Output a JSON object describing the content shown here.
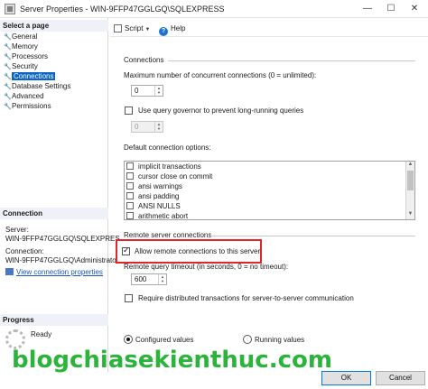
{
  "window": {
    "title": "Server Properties - WIN-9FFP47GGLGQ\\SQLEXPRESS",
    "controls": {
      "minimize": "—",
      "maximize": "☐",
      "close": "✕"
    }
  },
  "left_pane": {
    "select_page_header": "Select a page",
    "pages": [
      {
        "label": "General",
        "selected": false
      },
      {
        "label": "Memory",
        "selected": false
      },
      {
        "label": "Processors",
        "selected": false
      },
      {
        "label": "Security",
        "selected": false
      },
      {
        "label": "Connections",
        "selected": true
      },
      {
        "label": "Database Settings",
        "selected": false
      },
      {
        "label": "Advanced",
        "selected": false
      },
      {
        "label": "Permissions",
        "selected": false
      }
    ],
    "connection_header": "Connection",
    "server_label": "Server:",
    "server_value": "WIN-9FFP47GGLGQ\\SQLEXPRES",
    "connection_label": "Connection:",
    "connection_value": "WIN-9FFP47GGLGQ\\Administrato",
    "view_connection_link": "View connection properties",
    "progress_header": "Progress",
    "progress_status": "Ready"
  },
  "toolbar": {
    "script_label": "Script",
    "help_label": "Help"
  },
  "connections": {
    "group_label": "Connections",
    "max_connections_label": "Maximum number of concurrent connections (0 = unlimited):",
    "max_connections_value": "0",
    "query_governor_label": "Use query governor to prevent long-running queries",
    "query_governor_checked": false,
    "query_governor_value": "0",
    "default_options_label": "Default connection options:",
    "default_options": [
      "implicit transactions",
      "cursor close on commit",
      "ansi warnings",
      "ansi padding",
      "ANSI NULLS",
      "arithmetic abort"
    ]
  },
  "remote": {
    "group_label": "Remote server connections",
    "allow_remote_label": "Allow remote connections to this server",
    "allow_remote_checked": true,
    "timeout_label": "Remote query timeout (in seconds, 0 = no timeout):",
    "timeout_value": "600",
    "distributed_tx_label": "Require distributed transactions for server-to-server communication",
    "distributed_tx_checked": false
  },
  "values_mode": {
    "configured_label": "Configured values",
    "running_label": "Running values",
    "selected": "configured"
  },
  "buttons": {
    "ok": "OK",
    "cancel": "Cancel"
  },
  "watermark": "blogchiasekienthuc.com",
  "colors": {
    "selection": "#0a64c8",
    "highlight_border": "#e0262a",
    "watermark": "#2ab53a",
    "section_header_bg": "#eef2f8"
  }
}
